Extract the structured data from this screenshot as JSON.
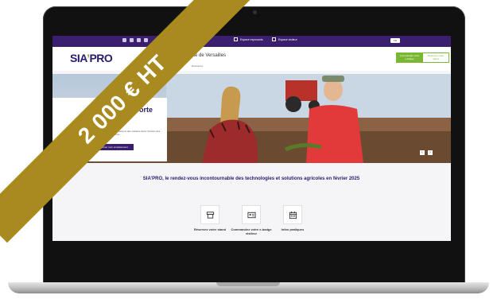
{
  "price_ribbon": {
    "text": "2 000 € HT",
    "color": "#a88a1f"
  },
  "site": {
    "brand_colors": {
      "primary": "#3b1f6e",
      "accent": "#7ab733"
    },
    "topbar": {
      "link_1": "Espace exposants",
      "link_2": "Espace visiteur",
      "lang": "FR"
    },
    "header": {
      "logo_main": "SIA",
      "logo_accent": "’",
      "logo_end": "PRO",
      "location": "Porte de Versailles",
      "sub": "Découvrez",
      "cta_primary": "Commandez votre e-badge",
      "cta_ghost": "Réservez votre stand"
    },
    "hero": {
      "title": "…au Parc… Porte de…",
      "text": "…rendez-vous des exposants et des visiteurs dans l'univers des Technologies et Solutions…",
      "button": "Réserver mon emplacement",
      "prev": "‹",
      "next": "›"
    },
    "tagline": "SIA’PRO, le rendez-vous incontournable des technologies et solutions agricoles en février 2025",
    "quick_links": [
      {
        "label": "Réservez votre stand",
        "icon": "stand-icon"
      },
      {
        "label": "Commandez votre e-badge visiteur",
        "icon": "badge-icon"
      },
      {
        "label": "Infos pratiques",
        "icon": "calendar-icon"
      }
    ]
  }
}
